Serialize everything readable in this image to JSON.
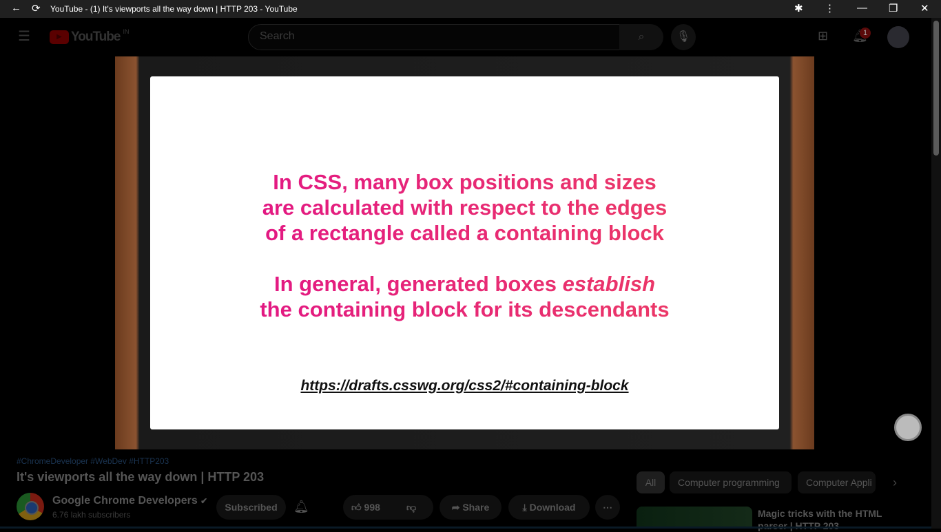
{
  "window": {
    "title": "YouTube - (1) It's viewports all the way down | HTTP 203 - YouTube"
  },
  "header": {
    "logo": "YouTube",
    "region": "IN",
    "search_placeholder": "Search",
    "notifications": "1"
  },
  "slide": {
    "para1": [
      "In CSS, many box positions and sizes",
      "are calculated with respect to the edges",
      "of a rectangle called a containing block"
    ],
    "para2_a": "In general, generated boxes ",
    "para2_em": "establish",
    "para2_b": "the containing block for its descendants",
    "url": "https://drafts.csswg.org/css2/#containing-block"
  },
  "video": {
    "hashtags": "#ChromeDeveloper #WebDev #HTTP203",
    "title": "It's viewports all the way down | HTTP 203",
    "channel": "Google Chrome Developers",
    "subscribers": "6.76 lakh subscribers",
    "subscribe_label": "Subscribed",
    "likes": "998",
    "share": "Share",
    "download": "Download",
    "more": "⋯"
  },
  "chips": [
    "All",
    "Computer programming",
    "Computer Appli"
  ],
  "recommended": {
    "title": "Magic tricks with the HTML parser | HTTP 203"
  }
}
